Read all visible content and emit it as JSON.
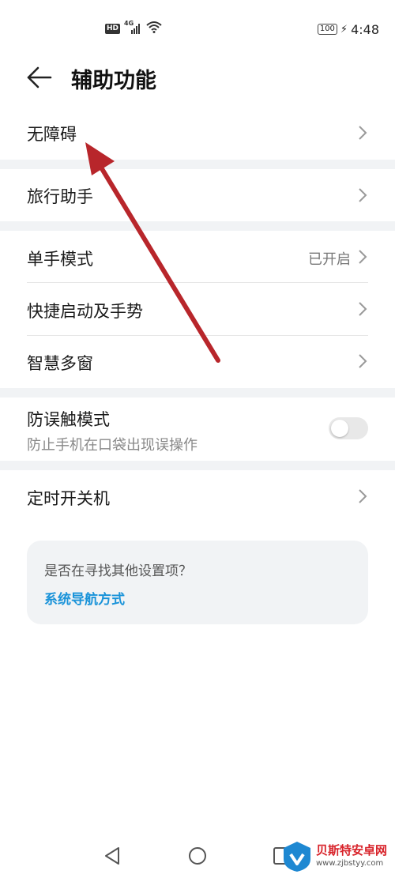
{
  "status_bar": {
    "hd": "HD",
    "network": "4G",
    "battery": "100",
    "time": "4:48"
  },
  "header": {
    "title": "辅助功能"
  },
  "items": {
    "accessibility": {
      "label": "无障碍"
    },
    "travel_assistant": {
      "label": "旅行助手"
    },
    "one_hand_mode": {
      "label": "单手模式",
      "value": "已开启"
    },
    "shortcuts_gestures": {
      "label": "快捷启动及手势"
    },
    "smart_multiwindow": {
      "label": "智慧多窗"
    },
    "pocket_mode": {
      "label": "防误触模式",
      "sublabel": "防止手机在口袋出现误操作",
      "enabled": false
    },
    "scheduled_power": {
      "label": "定时开关机"
    }
  },
  "suggestion": {
    "question": "是否在寻找其他设置项？",
    "link": "系统导航方式"
  },
  "watermark": {
    "name": "贝斯特安卓网",
    "url": "www.zjbstyy.com"
  },
  "colors": {
    "link": "#1a93d9",
    "arrow": "#b8262b",
    "section_gap": "#f1f3f5"
  }
}
